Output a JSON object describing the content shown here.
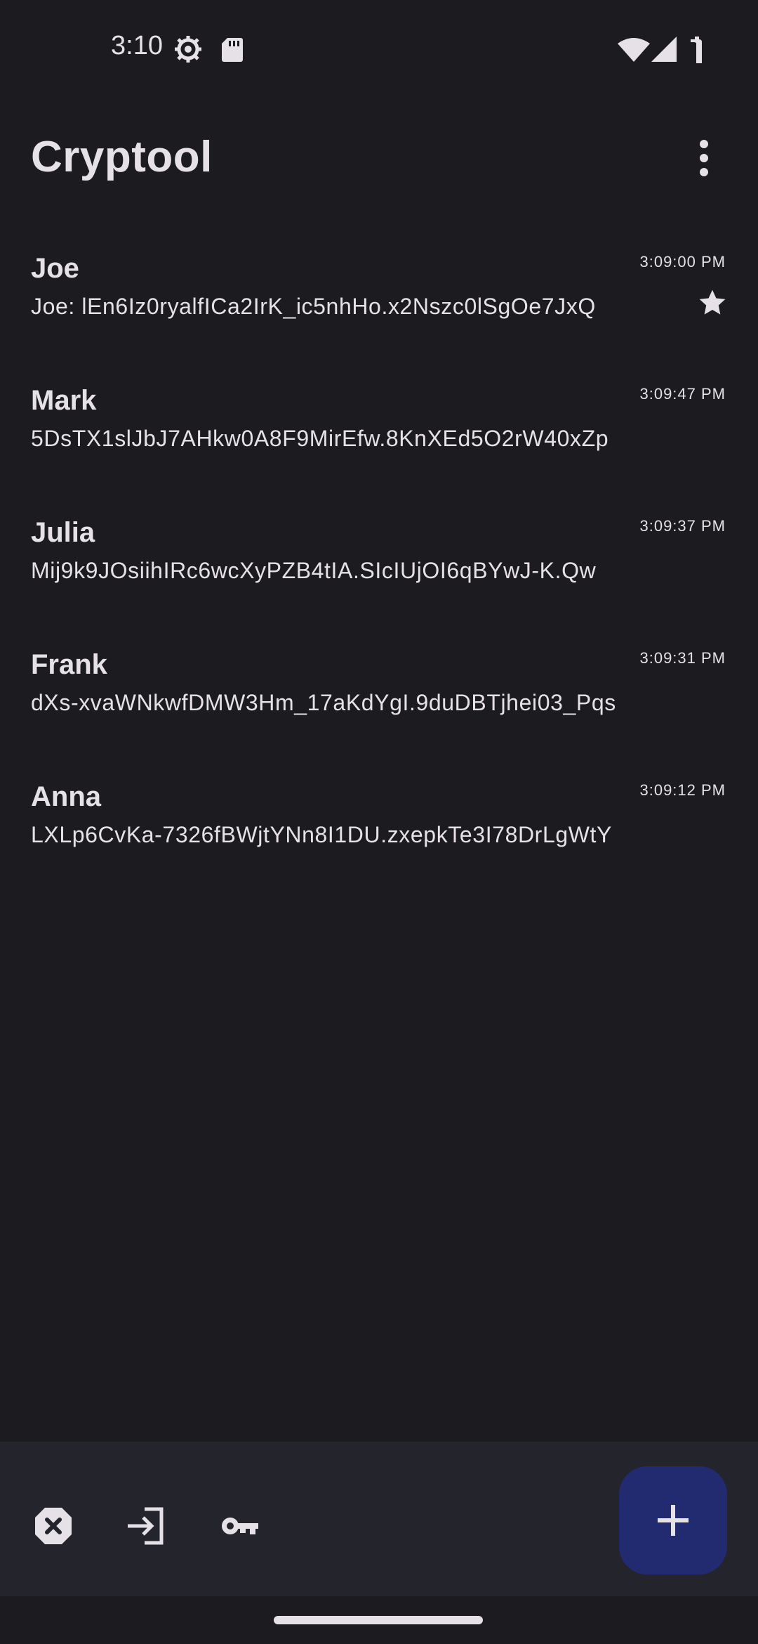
{
  "status_bar": {
    "time": "3:10",
    "icons": [
      "settings-icon",
      "sd-card-icon",
      "wifi-icon",
      "signal-icon",
      "battery-icon"
    ]
  },
  "app_bar": {
    "title": "Cryptool",
    "menu_icon": "more-vert-icon"
  },
  "conversations": [
    {
      "name": "Joe",
      "preview": "Joe: lEn6Iz0ryalfICa2IrK_ic5nhHo.x2Nszc0lSgOe7JxQ",
      "time": "3:09:00 PM",
      "starred": true
    },
    {
      "name": "Mark",
      "preview": "5DsTX1slJbJ7AHkw0A8F9MirEfw.8KnXEd5O2rW40xZp",
      "time": "3:09:47 PM",
      "starred": false
    },
    {
      "name": "Julia",
      "preview": "Mij9k9JOsiihIRc6wcXyPZB4tIA.SIcIUjOI6qBYwJ-K.Qw",
      "time": "3:09:37 PM",
      "starred": false
    },
    {
      "name": "Frank",
      "preview": "dXs-xvaWNkwfDMW3Hm_17aKdYgI.9duDBTjhei03_Pqs",
      "time": "3:09:31 PM",
      "starred": false
    },
    {
      "name": "Anna",
      "preview": "LXLp6CvKa-7326fBWjtYNn8I1DU.zxepkTe3I78DrLgWtY",
      "time": "3:09:12 PM",
      "starred": false
    }
  ],
  "bottom_bar": {
    "actions": [
      "close-octagon-icon",
      "login-icon",
      "key-icon"
    ],
    "fab_icon": "plus-icon"
  },
  "colors": {
    "background": "#1c1b20",
    "bottom_bar": "#24242d",
    "fab": "#222b70",
    "text": "#e6e1e6"
  }
}
